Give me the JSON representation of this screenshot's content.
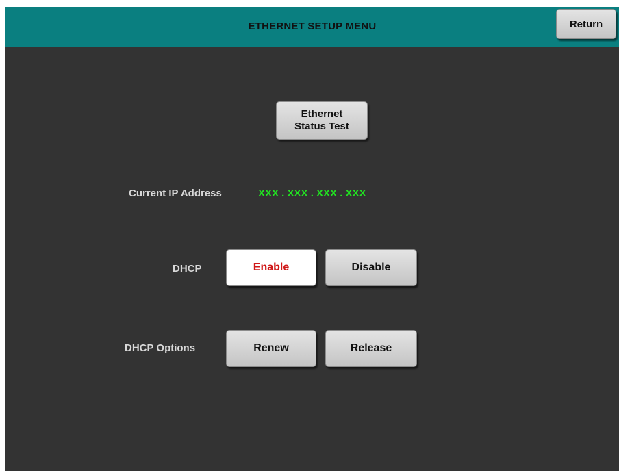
{
  "header": {
    "title": "ETHERNET SETUP MENU",
    "return_label": "Return",
    "color": "#0a7f80"
  },
  "status_test": {
    "line1": "Ethernet",
    "line2": "Status Test"
  },
  "ip": {
    "label": "Current IP Address",
    "value": "XXX . XXX . XXX . XXX",
    "value_color": "#22e022"
  },
  "dhcp": {
    "label": "DHCP",
    "enable_label": "Enable",
    "disable_label": "Disable",
    "selected": "Enable",
    "selected_color": "#d01818"
  },
  "dhcp_options": {
    "label": "DHCP Options",
    "renew_label": "Renew",
    "release_label": "Release"
  },
  "colors": {
    "background": "#333333",
    "button": "#d4d4d4"
  }
}
